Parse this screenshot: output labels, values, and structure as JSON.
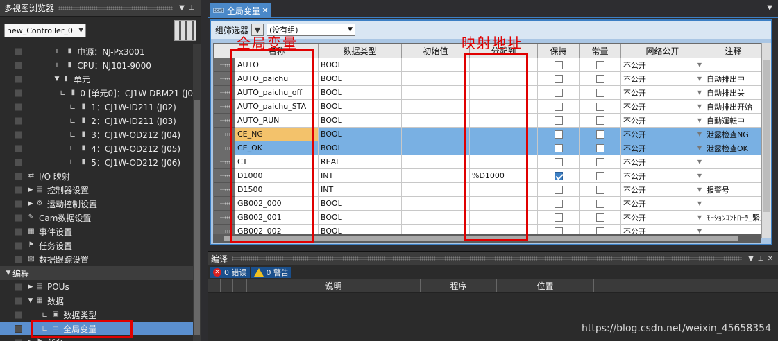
{
  "left_pane": {
    "title": "多视图浏览器",
    "controller": "new_Controller_0",
    "tree": [
      {
        "label": "电源：NJ-Px3001",
        "indent": 80,
        "kind": "leaf",
        "icon": "module-icon"
      },
      {
        "label": "CPU：NJ101-9000",
        "indent": 80,
        "kind": "leaf",
        "icon": "module-icon"
      },
      {
        "label": "单元",
        "indent": 76,
        "kind": "expanded",
        "icon": "folder-icon"
      },
      {
        "label": "0 [单元0]：CJ1W-DRM21 (J0",
        "indent": 100,
        "kind": "leaf",
        "icon": "module-icon"
      },
      {
        "label": "1：CJ1W-ID211 (J02)",
        "indent": 100,
        "kind": "leaf",
        "icon": "module-icon"
      },
      {
        "label": "2：CJ1W-ID211 (J03)",
        "indent": 100,
        "kind": "leaf",
        "icon": "module-icon"
      },
      {
        "label": "3：CJ1W-OD212 (J04)",
        "indent": 100,
        "kind": "leaf",
        "icon": "module-icon"
      },
      {
        "label": "4：CJ1W-OD212 (J05)",
        "indent": 100,
        "kind": "leaf",
        "icon": "module-icon"
      },
      {
        "label": "5：CJ1W-OD212 (J06)",
        "indent": 100,
        "kind": "leaf",
        "icon": "module-icon"
      },
      {
        "label": "I/O 映射",
        "indent": 38,
        "kind": "none",
        "icon": "io-map-icon"
      },
      {
        "label": "控制器设置",
        "indent": 38,
        "kind": "collapsed",
        "icon": "settings-icon"
      },
      {
        "label": "运动控制设置",
        "indent": 38,
        "kind": "collapsed",
        "icon": "motion-icon"
      },
      {
        "label": "Cam数据设置",
        "indent": 38,
        "kind": "none",
        "icon": "cam-icon"
      },
      {
        "label": "事件设置",
        "indent": 38,
        "kind": "none",
        "icon": "event-icon"
      },
      {
        "label": "任务设置",
        "indent": 38,
        "kind": "none",
        "icon": "task-icon"
      },
      {
        "label": "数据跟踪设置",
        "indent": 38,
        "kind": "none",
        "icon": "trace-icon"
      },
      {
        "label": "编程",
        "indent": 6,
        "kind": "section",
        "icon": ""
      },
      {
        "label": "POUs",
        "indent": 38,
        "kind": "collapsed",
        "icon": "pou-icon"
      },
      {
        "label": "数据",
        "indent": 38,
        "kind": "expanded",
        "icon": "data-icon"
      },
      {
        "label": "数据类型",
        "indent": 60,
        "kind": "leaf",
        "icon": "datatype-icon"
      },
      {
        "label": "全局变量",
        "indent": 60,
        "kind": "selected",
        "icon": "global-var-icon"
      },
      {
        "label": "任务",
        "indent": 38,
        "kind": "collapsed",
        "icon": "task-icon"
      }
    ]
  },
  "tab": {
    "label": "全局变量",
    "badge": "text"
  },
  "filter": {
    "label": "组筛选器",
    "value": "(没有组)"
  },
  "table": {
    "columns": [
      "名称",
      "数据类型",
      "初始值",
      "分配到",
      "保持",
      "常量",
      "网络公开",
      "注释"
    ],
    "rows": [
      {
        "name": "AUTO",
        "type": "BOOL",
        "init": "",
        "alloc": "",
        "retain": false,
        "const": false,
        "net": "不公开",
        "comment": "",
        "hl": ""
      },
      {
        "name": "AUTO_paichu",
        "type": "BOOL",
        "init": "",
        "alloc": "",
        "retain": false,
        "const": false,
        "net": "不公开",
        "comment": "自动排出中",
        "hl": ""
      },
      {
        "name": "AUTO_paichu_off",
        "type": "BOOL",
        "init": "",
        "alloc": "",
        "retain": false,
        "const": false,
        "net": "不公开",
        "comment": "自动排出关",
        "hl": ""
      },
      {
        "name": "AUTO_paichu_STA",
        "type": "BOOL",
        "init": "",
        "alloc": "",
        "retain": false,
        "const": false,
        "net": "不公开",
        "comment": "自动排出开始",
        "hl": ""
      },
      {
        "name": "AUTO_RUN",
        "type": "BOOL",
        "init": "",
        "alloc": "",
        "retain": false,
        "const": false,
        "net": "不公开",
        "comment": "自動運転中",
        "hl": ""
      },
      {
        "name": "CE_NG",
        "type": "BOOL",
        "init": "",
        "alloc": "",
        "retain": false,
        "const": false,
        "net": "不公开",
        "comment": "泄露检查NG",
        "hl": "hl"
      },
      {
        "name": "CE_OK",
        "type": "BOOL",
        "init": "",
        "alloc": "",
        "retain": false,
        "const": false,
        "net": "不公开",
        "comment": "泄露检查OK",
        "hl": "hl hl2"
      },
      {
        "name": "CT",
        "type": "REAL",
        "init": "",
        "alloc": "",
        "retain": false,
        "const": false,
        "net": "不公开",
        "comment": "",
        "hl": ""
      },
      {
        "name": "D1000",
        "type": "INT",
        "init": "",
        "alloc": "%D1000",
        "retain": true,
        "const": false,
        "net": "不公开",
        "comment": "",
        "hl": ""
      },
      {
        "name": "D1500",
        "type": "INT",
        "init": "",
        "alloc": "",
        "retain": false,
        "const": false,
        "net": "不公开",
        "comment": "报警号",
        "hl": ""
      },
      {
        "name": "GB002_000",
        "type": "BOOL",
        "init": "",
        "alloc": "",
        "retain": false,
        "const": false,
        "net": "不公开",
        "comment": "",
        "hl": ""
      },
      {
        "name": "GB002_001",
        "type": "BOOL",
        "init": "",
        "alloc": "",
        "retain": false,
        "const": false,
        "net": "不公开",
        "comment": "ﾓｰｼｮﾝｺﾝﾄﾛｰﾗ_緊急",
        "hl": ""
      },
      {
        "name": "GB002_002",
        "type": "BOOL",
        "init": "",
        "alloc": "",
        "retain": false,
        "const": false,
        "net": "不公开",
        "comment": "",
        "hl": ""
      }
    ]
  },
  "annotations": {
    "name_label": "全局变量",
    "alloc_label": "映射地址"
  },
  "build": {
    "title": "编译",
    "errors": "0 错误",
    "warnings": "0 警告",
    "columns": [
      "说明",
      "程序",
      "位置"
    ]
  },
  "watermark": "https://blog.csdn.net/weixin_45658354"
}
